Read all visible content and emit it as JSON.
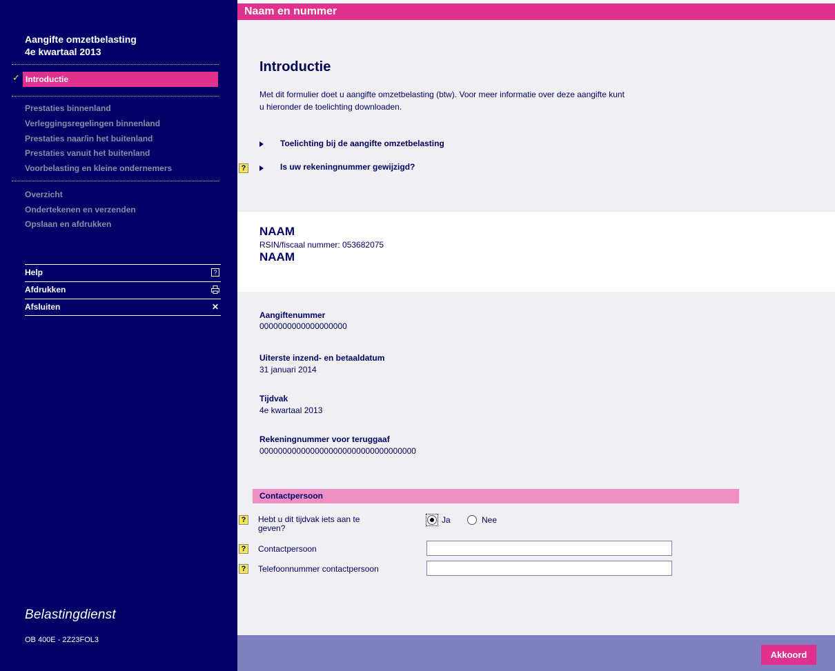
{
  "sidebar": {
    "title_line1": "Aangifte omzetbelasting",
    "title_line2": "4e kwartaal 2013",
    "active_item": "Introductie",
    "group1": [
      "Prestaties binnenland",
      "Verleggingsregelingen binnenland",
      "Prestaties naar/in het buitenland",
      "Prestaties vanuit het buitenland",
      "Voorbelasting en kleine ondernemers"
    ],
    "group2": [
      "Overzicht",
      "Ondertekenen en verzenden",
      "Opslaan en afdrukken"
    ],
    "tools": {
      "help": "Help",
      "print": "Afdrukken",
      "close": "Afsluiten"
    },
    "icons": {
      "check": "checkmark-icon",
      "help": "help-icon",
      "print": "printer-icon",
      "close": "close-icon"
    },
    "brand": "Belastingdienst",
    "form_code": "OB 400E - 2Z23FOL3"
  },
  "header": {
    "title": "Naam en nummer"
  },
  "intro": {
    "heading": "Introductie",
    "text_line1": "Met dit formulier doet u aangifte omzetbelasting (btw). Voor meer informatie over deze aangifte kunt",
    "text_line2": "u hieronder de toelichting downloaden.",
    "link1": "Toelichting bij de aangifte omzetbelasting",
    "link2": "Is uw rekeningnummer gewijzigd?"
  },
  "identity": {
    "name1": "NAAM",
    "rsin": "RSIN/fiscaal nummer: 053682075",
    "name2": "NAAM"
  },
  "details": {
    "aangiftenummer_label": "Aangiftenummer",
    "aangiftenummer_value": "0000000000000000000",
    "datum_label": "Uiterste inzend- en betaaldatum",
    "datum_value": "31 januari 2014",
    "tijdvak_label": "Tijdvak",
    "tijdvak_value": "4e kwartaal 2013",
    "rekening_label": "Rekeningnummer voor teruggaaf",
    "rekening_value": "0000000000000000000000000000000000"
  },
  "contact": {
    "section_title": "Contactpersoon",
    "question_line1": "Hebt u dit tijdvak iets aan te",
    "question_line2": "geven?",
    "option_yes": "Ja",
    "option_no": "Nee",
    "selected": "Ja",
    "contact_label": "Contactpersoon",
    "contact_value": "",
    "phone_label": "Telefoonnummer contactpersoon",
    "phone_value": "",
    "help_glyph": "?"
  },
  "footer": {
    "button": "Akkoord"
  },
  "colors": {
    "sidebar": "#000066",
    "accent": "#e0318e",
    "section": "#f08fc4",
    "footer": "#8080c0",
    "panel": "#efeff4"
  }
}
